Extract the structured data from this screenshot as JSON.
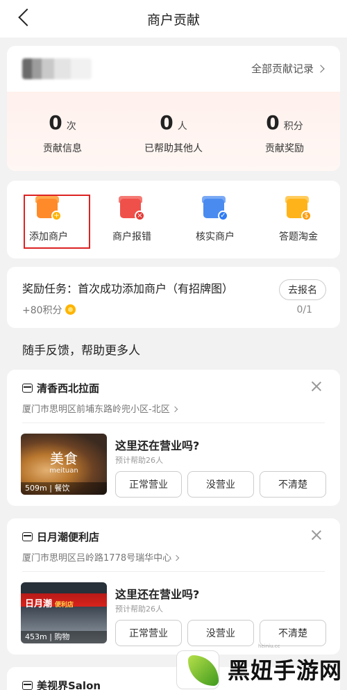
{
  "header": {
    "title": "商户贡献"
  },
  "user": {
    "all_records_label": "全部贡献记录"
  },
  "stats": [
    {
      "value": "0",
      "unit": "次",
      "label": "贡献信息"
    },
    {
      "value": "0",
      "unit": "人",
      "label": "已帮助其他人"
    },
    {
      "value": "0",
      "unit": "积分",
      "label": "贡献奖励"
    }
  ],
  "actions": [
    {
      "label": "添加商户",
      "icon": "add-store-icon",
      "color": "#ff8a2a",
      "badge_color": "#ffb300"
    },
    {
      "label": "商户报错",
      "icon": "report-store-icon",
      "color": "#f0504a",
      "badge_color": "#e53935"
    },
    {
      "label": "核实商户",
      "icon": "verify-store-icon",
      "color": "#4a8bf0",
      "badge_color": "#2f7cf6"
    },
    {
      "label": "答题淘金",
      "icon": "quiz-gold-icon",
      "color": "#ffb31a",
      "badge_color": "#ff9800"
    }
  ],
  "task": {
    "title": "奖励任务：首次成功添加商户（有招牌图）",
    "points": "+80积分",
    "button_label": "去报名",
    "progress": "0/1"
  },
  "section_title": "随手反馈，帮助更多人",
  "stores": [
    {
      "name": "清香西北拉面",
      "address": "厦门市思明区前埔东路岭兜小区-北区",
      "thumb_title": "美食",
      "thumb_sub": "meituan",
      "thumb_tag": "509m | 餐饮",
      "question": "这里还在营业吗?",
      "help_note": "预计帮助26人",
      "options": [
        "正常营业",
        "没营业",
        "不清楚"
      ]
    },
    {
      "name": "日月潮便利店",
      "address": "厦门市思明区吕岭路1778号瑞华中心",
      "thumb_sign": "日月潮",
      "thumb_sign_sub": "便利店",
      "thumb_tag": "453m | 购物",
      "question": "这里还在营业吗?",
      "help_note": "预计帮助26人",
      "options": [
        "正常营业",
        "没营业",
        "不清楚"
      ]
    },
    {
      "name": "美视界Salon"
    }
  ],
  "watermark": {
    "text": "黑妞手游网",
    "url": "heiniu.cc"
  }
}
